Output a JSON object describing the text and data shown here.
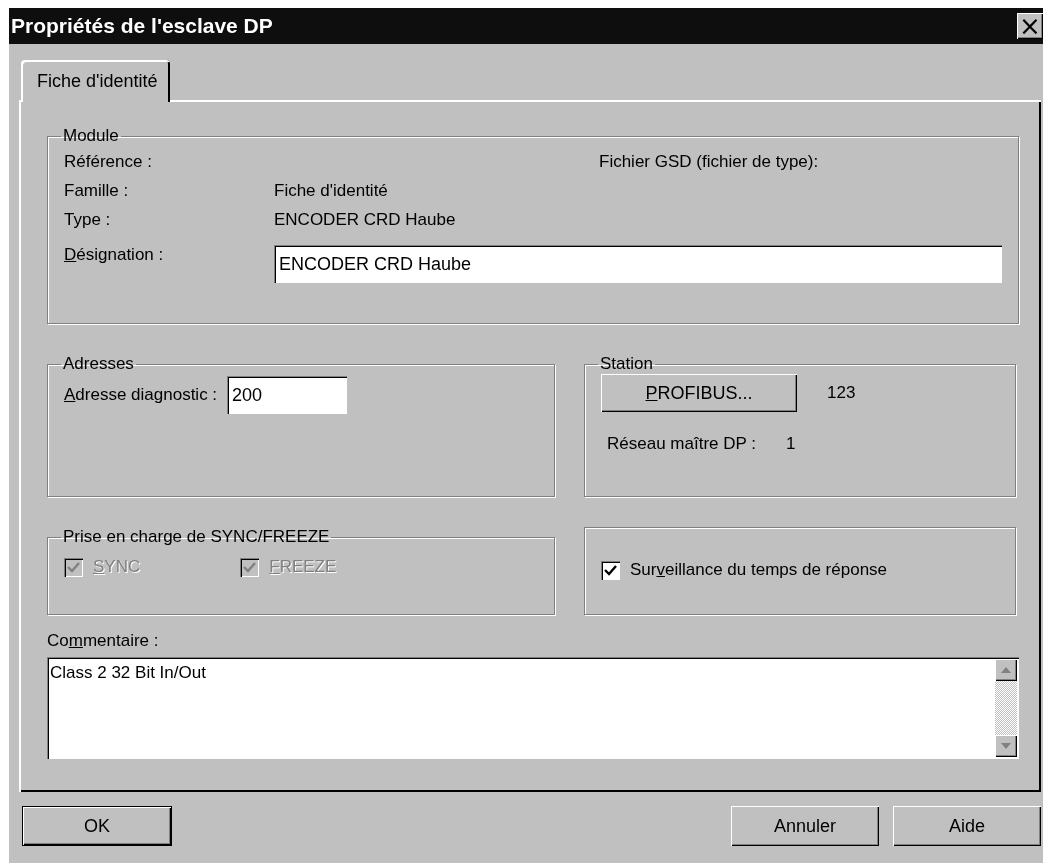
{
  "window": {
    "title": "Propriétés de l'esclave DP",
    "close": "×"
  },
  "tabs": [
    {
      "label": "Fiche d'identité",
      "selected": true
    }
  ],
  "module": {
    "legend": "Module",
    "rows": [
      {
        "label": {
          "before": "Référence :"
        }
      },
      {
        "label": {
          "before": "Famille :"
        },
        "value": "Fiche d'identité"
      },
      {
        "label": {
          "before": "Type :"
        },
        "value": "ENCODER CRD Haube"
      }
    ],
    "gsd_label": "Fichier GSD (fichier de type):",
    "designation": {
      "label": {
        "key": "D",
        "after": "ésignation :"
      },
      "value": "ENCODER CRD Haube"
    }
  },
  "addresses": {
    "legend": "Adresses",
    "diagnostic": {
      "label": {
        "key": "A",
        "after": "dresse diagnostic :"
      },
      "value": "200"
    }
  },
  "station": {
    "legend": "Station",
    "button": {
      "key": "P",
      "after": "ROFIBUS..."
    },
    "number": "123",
    "master_label": "Réseau maître DP :",
    "master_value": "1"
  },
  "sync_freeze": {
    "legend": "Prise en charge de SYNC/FREEZE",
    "checkboxes": [
      {
        "label": {
          "key": "S",
          "after": "YNC"
        },
        "checked": true,
        "disabled": true
      },
      {
        "label": {
          "key": "F",
          "after": "REEZE"
        },
        "checked": true,
        "disabled": true
      }
    ]
  },
  "monitoring": {
    "label": {
      "before": "Sur",
      "key": "v",
      "after": "eillance du temps de réponse"
    },
    "checked": true,
    "disabled": false
  },
  "comment": {
    "label": {
      "before": "Co",
      "key": "m",
      "after": "mentaire :"
    },
    "value": "Class 2  32 Bit In/Out"
  },
  "buttons": [
    {
      "label": "OK",
      "default": true
    },
    {
      "label": "Annuler",
      "default": false
    },
    {
      "label": "Aide",
      "default": false
    }
  ]
}
